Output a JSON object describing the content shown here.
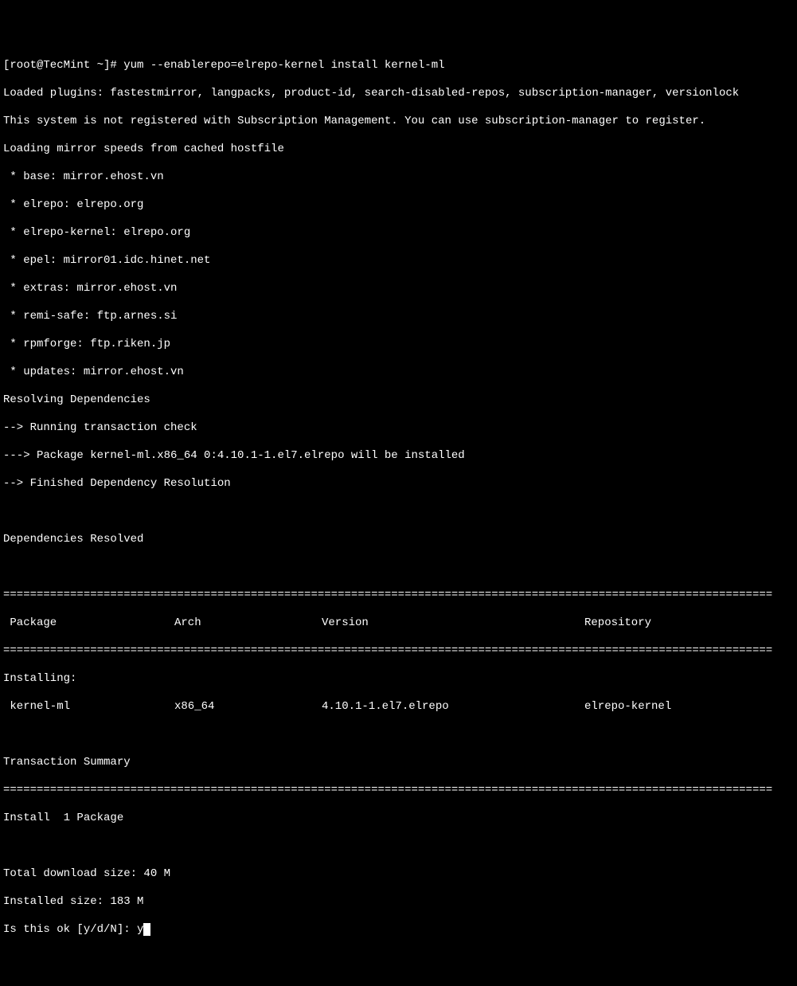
{
  "prompt": {
    "user_host": "[root@TecMint ~]#",
    "command": "yum --enablerepo=elrepo-kernel install kernel-ml"
  },
  "output": {
    "loaded_plugins": "Loaded plugins: fastestmirror, langpacks, product-id, search-disabled-repos, subscription-manager, versionlock",
    "not_registered": "This system is not registered with Subscription Management. You can use subscription-manager to register.",
    "loading_mirror": "Loading mirror speeds from cached hostfile",
    "mirrors": [
      " * base: mirror.ehost.vn",
      " * elrepo: elrepo.org",
      " * elrepo-kernel: elrepo.org",
      " * epel: mirror01.idc.hinet.net",
      " * extras: mirror.ehost.vn",
      " * remi-safe: ftp.arnes.si",
      " * rpmforge: ftp.riken.jp",
      " * updates: mirror.ehost.vn"
    ],
    "resolving": "Resolving Dependencies",
    "transaction_check": "--> Running transaction check",
    "package_install": "---> Package kernel-ml.x86_64 0:4.10.1-1.el7.elrepo will be installed",
    "finished_resolution": "--> Finished Dependency Resolution",
    "deps_resolved": "Dependencies Resolved"
  },
  "table": {
    "header": {
      "package": " Package",
      "arch": "Arch",
      "version": "Version",
      "repository": "Repository"
    },
    "installing_label": "Installing:",
    "row": {
      "package": " kernel-ml",
      "arch": "x86_64",
      "version": "4.10.1-1.el7.elrepo",
      "repository": "elrepo-kernel"
    }
  },
  "summary": {
    "title": "Transaction Summary",
    "install": "Install  1 Package",
    "download_size": "Total download size: 40 M",
    "installed_size": "Installed size: 183 M",
    "confirm_prompt": "Is this ok [y/d/N]: ",
    "user_input": "y"
  },
  "divider": "==================================================================================================================="
}
